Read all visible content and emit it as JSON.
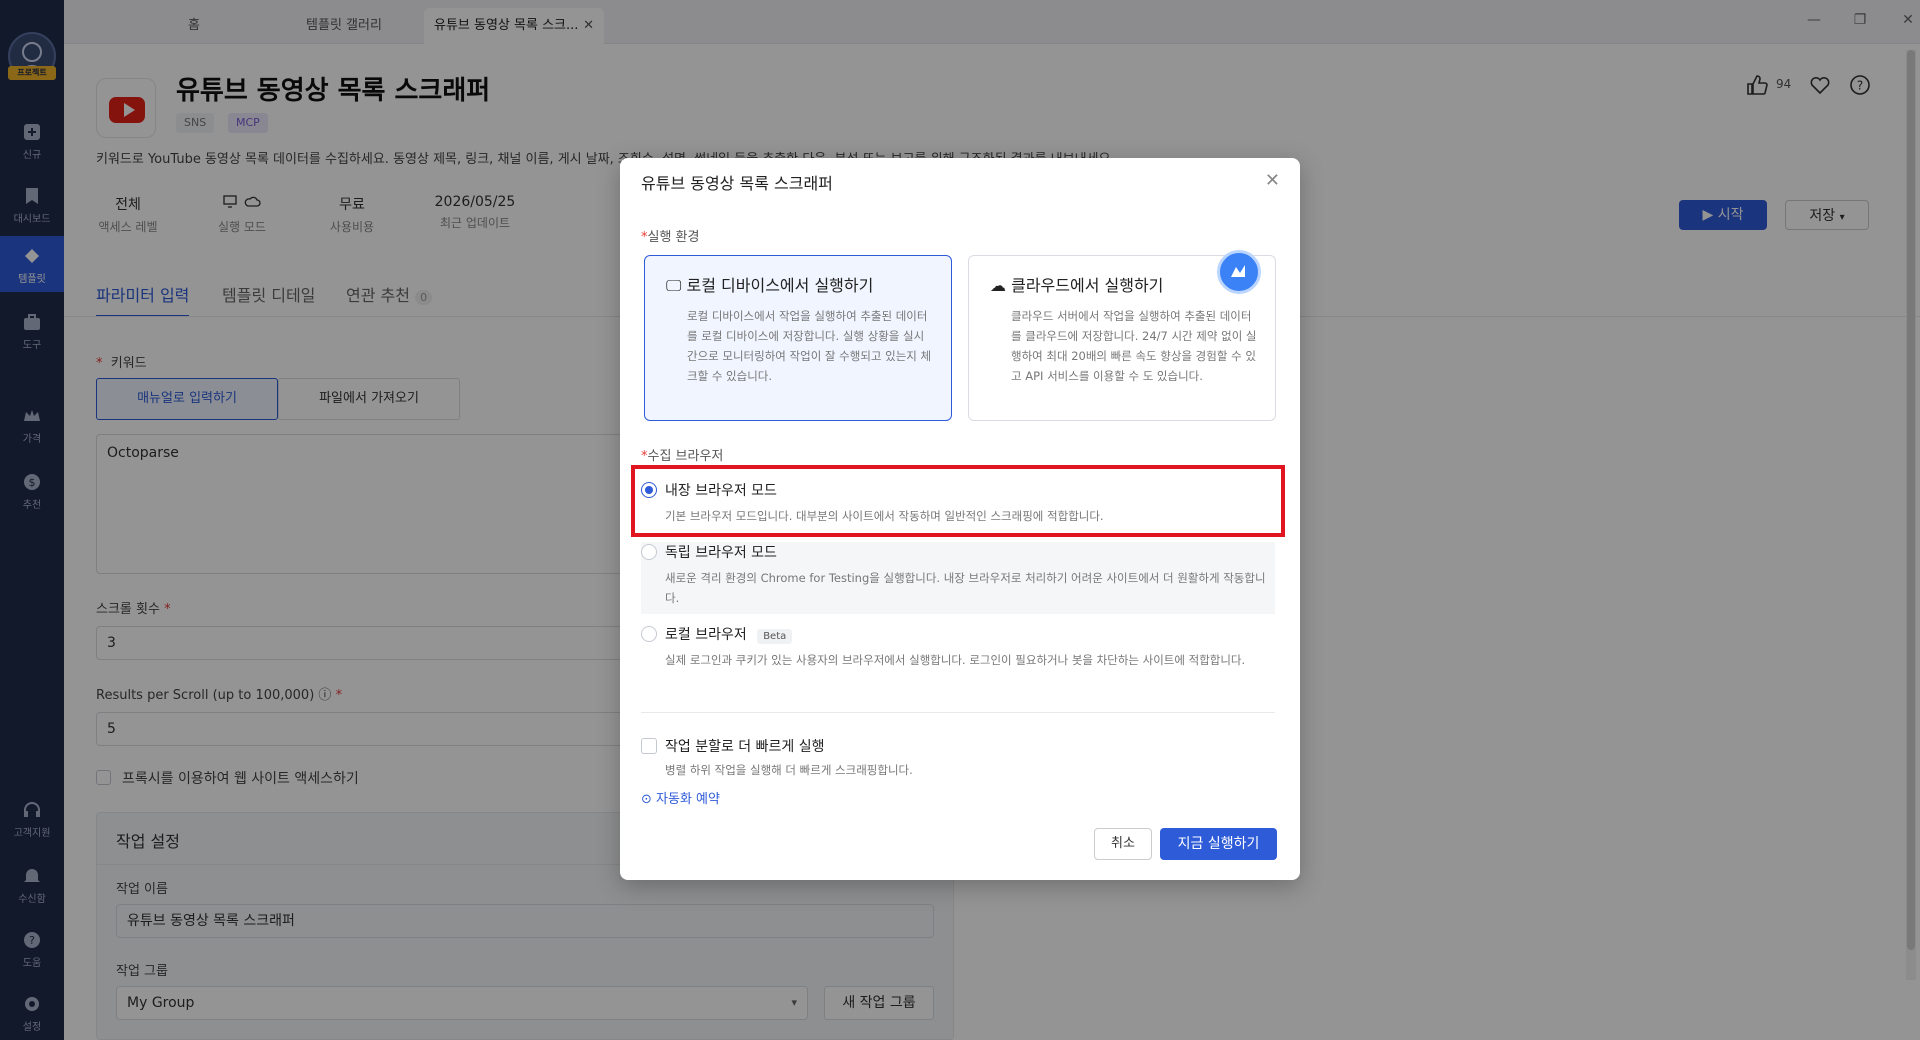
{
  "window": {
    "tabs": [
      {
        "label": "홈"
      },
      {
        "label": "템플릿 갤러리"
      },
      {
        "label": "유튜브 동영상 목록 스크..."
      }
    ],
    "controls": {
      "minimize": "—",
      "restore": "❐",
      "close": "✕"
    }
  },
  "sidebar": {
    "logo_badge": "프로젝트",
    "items": [
      {
        "label": "신규",
        "icon": "plus-box-icon"
      },
      {
        "label": "대시보드",
        "icon": "bookmark-icon"
      },
      {
        "label": "템플릿",
        "icon": "template-icon"
      },
      {
        "label": "도구",
        "icon": "toolbox-icon"
      },
      {
        "label": "가격",
        "icon": "crown-icon"
      },
      {
        "label": "추천",
        "icon": "dollar-icon"
      },
      {
        "label": "고객지원",
        "icon": "headset-icon"
      },
      {
        "label": "수신함",
        "icon": "bell-icon"
      },
      {
        "label": "도움",
        "icon": "help-icon"
      },
      {
        "label": "설정",
        "icon": "gear-icon"
      }
    ]
  },
  "header": {
    "title": "유튜브 동영상 목록 스크래퍼",
    "tags": [
      "SNS",
      "MCP"
    ],
    "likes": "94",
    "description": "키워드로 YouTube 동영상 목록 데이터를 수집하세요. 동영상 제목, 링크, 채널 이름, 게시 날짜, 조회수, 설명, 썸네일 등을 추출한 다음, 분석 또는 보고를 위해 구조화된 결과를 내보내세요.",
    "meta": [
      {
        "value": "전체",
        "label": "액세스 레벨"
      },
      {
        "value": "",
        "label": "실행 모드"
      },
      {
        "value": "무료",
        "label": "사용비용"
      },
      {
        "value": "2026/05/25",
        "label": "최근 업데이트"
      }
    ],
    "start_label": "시작",
    "save_label": "저장"
  },
  "page_tabs": {
    "params": "파라미터 입력",
    "detail": "템플릿 디테일",
    "related": "연관 추천",
    "related_count": "0"
  },
  "form": {
    "keyword_label": "키워드",
    "manual_label": "매뉴얼로 입력하기",
    "file_label": "파일에서 가져오기",
    "keyword_value": "Octoparse",
    "scroll_label": "스크롤 횟수",
    "scroll_value": "3",
    "results_label": "Results per Scroll (up to 100,000)",
    "results_value": "5",
    "proxy_label": "프록시를 이용하여 웹 사이트 액세스하기",
    "task_settings": "작업 설정",
    "task_name_label": "작업 이름",
    "task_name_value": "유튜브 동영상 목록 스크래퍼",
    "task_group_label": "작업 그룹",
    "task_group_value": "My Group",
    "new_group_label": "새 작업 그룹"
  },
  "modal": {
    "title": "유튜브 동영상 목록 스크래퍼",
    "env_label": "실행 환경",
    "local": {
      "title": "로컬 디바이스에서 실행하기",
      "desc": "로컬 디바이스에서 작업을 실행하여 추출된 데이터를 로컬 디바이스에 저장합니다. 실행 상황을 실시간으로 모니터링하여 작업이 잘 수행되고 있는지 체크할 수 있습니다."
    },
    "cloud": {
      "title": "클라우드에서 실행하기",
      "desc": "클라우드 서버에서 작업을 실행하여 추출된 데이터를 클라우드에 저장합니다. 24/7 시간 제약 없이 실행하여 최대 20배의 빠른 속도 향상을 경험할 수 있고 API 서비스를 이용할 수 도 있습니다."
    },
    "browser_label": "수집 브라우저",
    "options": [
      {
        "title": "내장 브라우저 모드",
        "desc": "기본 브라우저 모드입니다. 대부분의 사이트에서 작동하며 일반적인 스크래핑에 적합합니다."
      },
      {
        "title": "독립 브라우저 모드",
        "desc": "새로운 격리 환경의 Chrome for Testing을 실행합니다. 내장 브라우저로 처리하기 어려운 사이트에서 더 원활하게 작동합니다."
      },
      {
        "title": "로컬 브라우저",
        "badge": "Beta",
        "desc": "실제 로그인과 쿠키가 있는 사용자의 브라우저에서 실행합니다. 로그인이 필요하거나 봇을 차단하는 사이트에 적합합니다."
      }
    ],
    "split": {
      "title": "작업 분할로 더 빠르게 실행",
      "desc": "병렬 하위 작업을 실행해 더 빠르게 스크래핑합니다."
    },
    "schedule_label": "자동화 예약",
    "cancel_label": "취소",
    "run_label": "지금 실행하기"
  },
  "colors": {
    "accent": "#2e5bd8",
    "sidebar": "#1f2b4a",
    "highlight": "#e0151f"
  }
}
